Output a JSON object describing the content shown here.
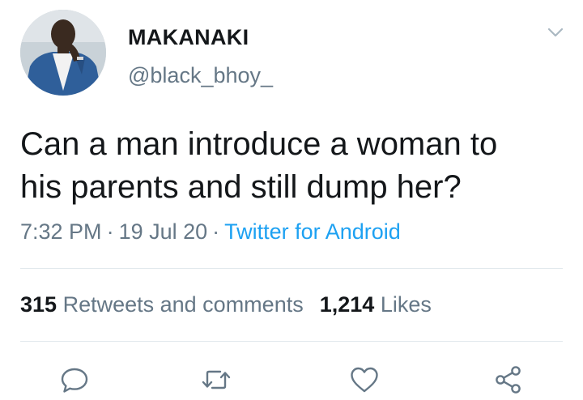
{
  "author": {
    "display_name": "MAKANAKI",
    "handle": "@black_bhoy_"
  },
  "tweet": {
    "text_line1": "Can a man introduce a woman to",
    "text_line2": "his parents and still dump her?",
    "time": "7:32 PM",
    "date": "19 Jul 20",
    "separator": "·",
    "source": "Twitter for Android"
  },
  "stats": {
    "retweets_count": "315",
    "retweets_label": "Retweets and comments",
    "likes_count": "1,214",
    "likes_label": "Likes"
  },
  "icons": {
    "caret": "chevron-down-icon",
    "reply": "reply-icon",
    "retweet": "retweet-icon",
    "like": "heart-icon",
    "share": "share-icon"
  },
  "colors": {
    "text": "#14171a",
    "secondary": "#657786",
    "link": "#1da1f2",
    "divider": "#e1e8ed"
  }
}
